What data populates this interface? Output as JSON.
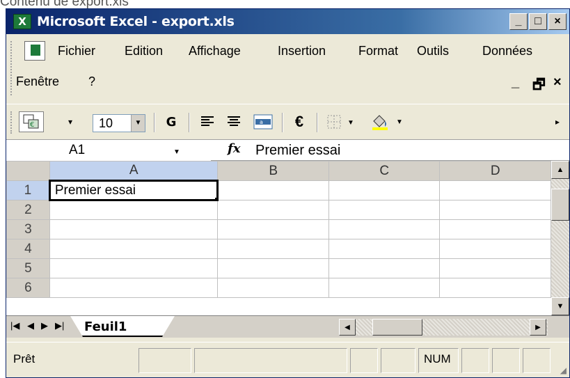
{
  "caption": "Contenu de export.xls",
  "window": {
    "title": "Microsoft Excel - export.xls",
    "controls": {
      "minimize": "_",
      "maximize": "□",
      "close": "×"
    }
  },
  "menubar": {
    "items": [
      {
        "label": "Fichier"
      },
      {
        "label": "Edition"
      },
      {
        "label": "Affichage"
      },
      {
        "label": "Insertion"
      },
      {
        "label": "Format"
      },
      {
        "label": "Outils"
      },
      {
        "label": "Données"
      },
      {
        "label": "Fenêtre"
      },
      {
        "label": "?"
      }
    ],
    "doc_controls": {
      "minimize": "_",
      "restore": "🗗",
      "close": "×"
    }
  },
  "toolbar": {
    "font_size": "10",
    "bold_label": "G",
    "euro_label": "€",
    "icons": [
      "copy-format-icon",
      "bold-icon",
      "align-left-icon",
      "align-center-icon",
      "merge-center-icon",
      "euro-icon",
      "borders-icon",
      "fill-color-icon"
    ]
  },
  "formulabar": {
    "cell_ref": "A1",
    "fx_label": "fx",
    "value": "Premier essai"
  },
  "grid": {
    "columns": [
      "A",
      "B",
      "C",
      "D"
    ],
    "rows": [
      "1",
      "2",
      "3",
      "4",
      "5",
      "6"
    ],
    "cells": {
      "A1": "Premier essai"
    },
    "active_cell": "A1"
  },
  "sheets": {
    "tabs": [
      "Feuil1"
    ],
    "active": "Feuil1"
  },
  "statusbar": {
    "status": "Prêt",
    "num": "NUM"
  },
  "colors": {
    "title_gradient_start": "#0a246a",
    "title_gradient_end": "#a6caf0",
    "chrome": "#ece9d8",
    "header": "#d4d0c8",
    "active_header": "#c1d2ee"
  }
}
